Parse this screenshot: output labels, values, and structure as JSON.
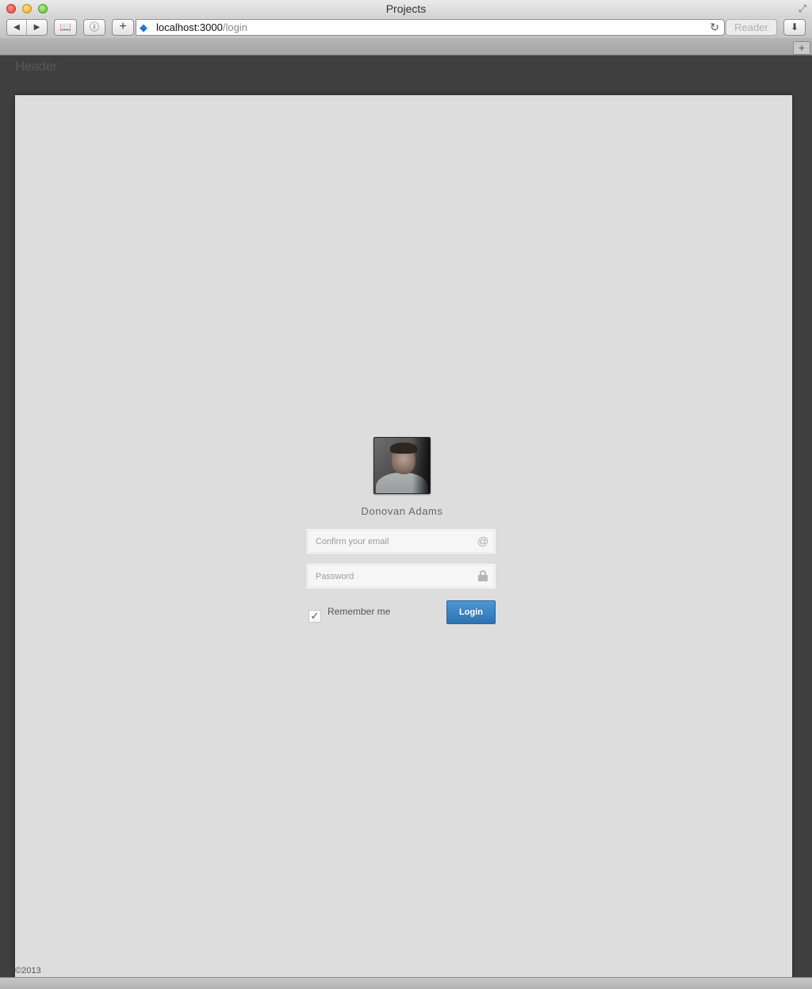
{
  "window": {
    "title": "Projects"
  },
  "toolbar": {
    "back_glyph": "◀",
    "forward_glyph": "▶",
    "bookmarks_glyph": "📖",
    "info_glyph": "ⓘ",
    "add_glyph": "+",
    "url_host": "localhost:3000",
    "url_path": "/login",
    "reload_glyph": "↻",
    "reader_label": "Reader",
    "downloads_glyph": "⬇"
  },
  "tabstrip": {
    "new_tab_glyph": "+"
  },
  "page": {
    "header_text": "Header",
    "footer_text": "©2013",
    "login": {
      "user_name": "Donovan Adams",
      "email_placeholder": "Confirm your email",
      "email_value": "",
      "email_icon": "@",
      "password_placeholder": "Password",
      "password_value": "",
      "remember_checked": true,
      "remember_label": "Remember me",
      "check_glyph": "✓",
      "submit_label": "Login"
    }
  },
  "colors": {
    "page_background": "#3f3f3f",
    "panel_background": "#dddddd",
    "button_accent": "#3a84c4"
  }
}
